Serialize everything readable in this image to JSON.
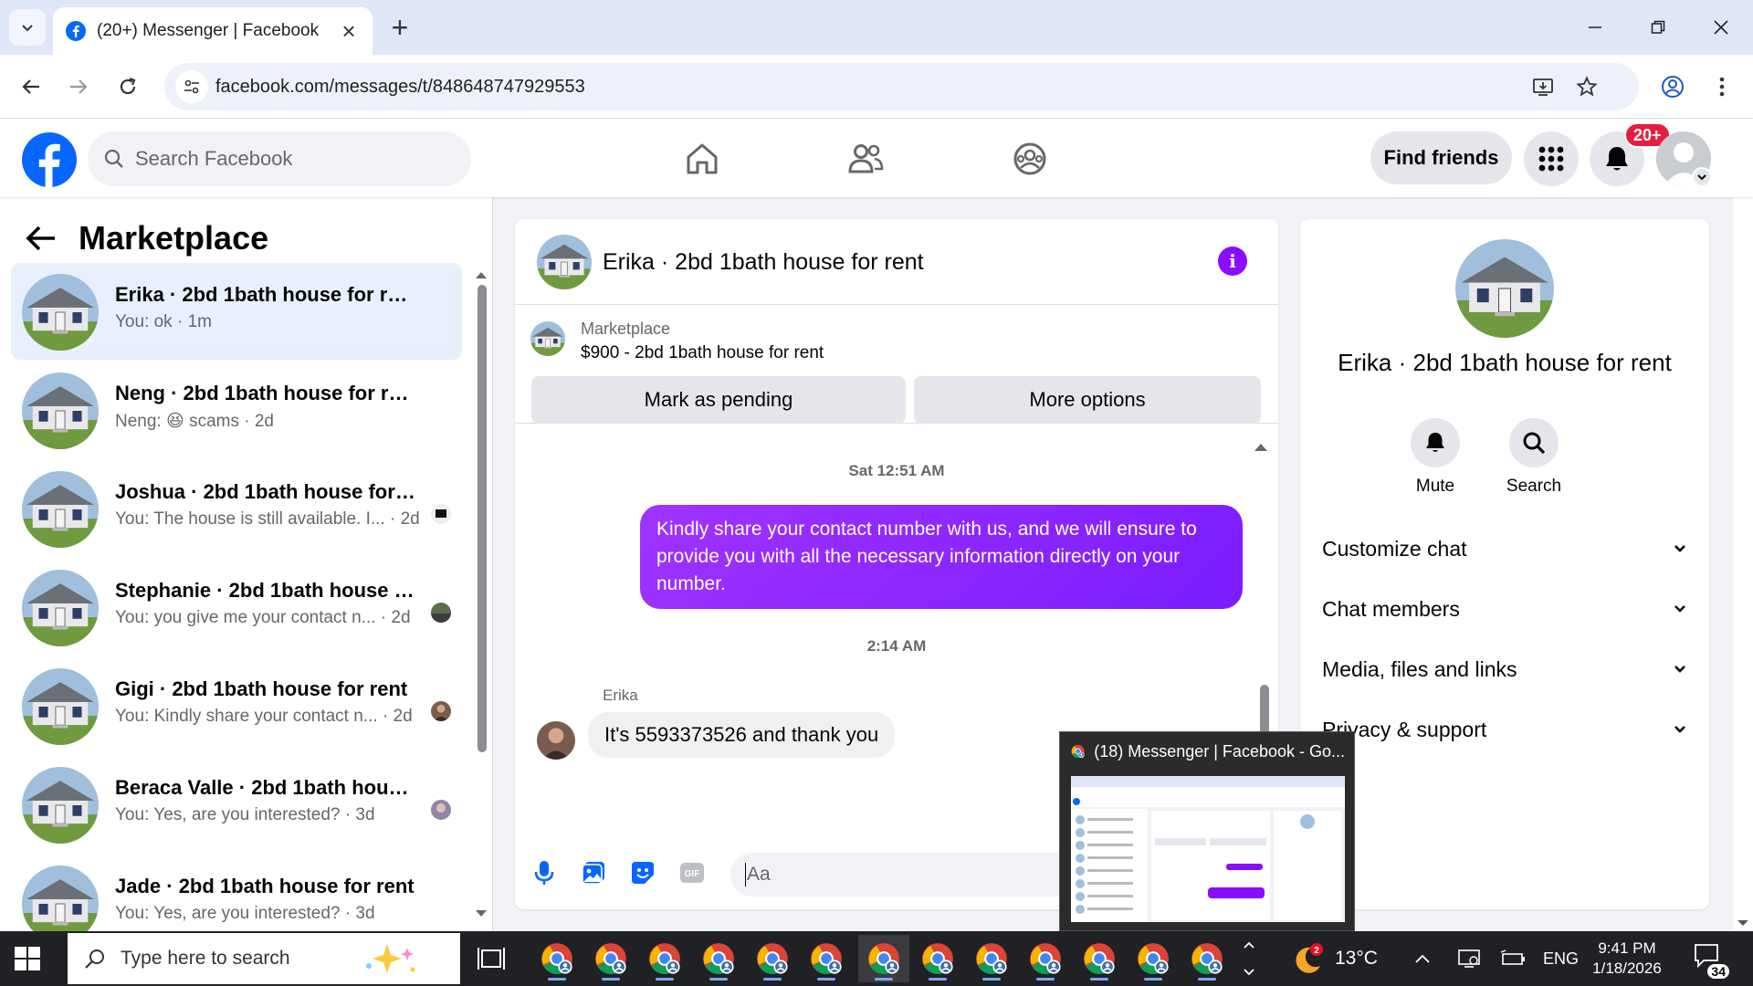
{
  "browser": {
    "tab_title": "(20+) Messenger | Facebook",
    "url": "facebook.com/messages/t/848648747929553"
  },
  "facebook": {
    "search_placeholder": "Search Facebook",
    "find_friends": "Find friends",
    "notif_badge": "20+"
  },
  "sidebar": {
    "title": "Marketplace",
    "conversations": [
      {
        "name": "Erika · 2bd 1bath house for rent",
        "preview": "You: ok · 1m",
        "active": true
      },
      {
        "name": "Neng · 2bd 1bath house for rent",
        "preview": "Neng: 😆 scams · 2d"
      },
      {
        "name": "Joshua · 2bd 1bath house for r...",
        "preview": "You: The house is still available. I... · 2d"
      },
      {
        "name": "Stephanie · 2bd 1bath house f...",
        "preview": "You: you give me your contact n... · 2d"
      },
      {
        "name": "Gigi · 2bd 1bath house for rent",
        "preview": "You: Kindly share your contact n... · 2d"
      },
      {
        "name": "Beraca Valle · 2bd 1bath hous...",
        "preview": "You: Yes, are you interested? · 3d"
      },
      {
        "name": "Jade · 2bd 1bath house for rent",
        "preview": "You: Yes, are you interested? · 3d"
      }
    ]
  },
  "chat": {
    "title": "Erika · 2bd 1bath house for rent",
    "marketplace_label": "Marketplace",
    "listing": "$900 - 2bd 1bath house for rent",
    "mark_pending": "Mark as pending",
    "more_options": "More options",
    "timestamp1": "Sat 12:51 AM",
    "outgoing_message": "Kindly share your contact number with us, and we will ensure to provide you with all the necessary information directly on your number.",
    "timestamp2": "2:14 AM",
    "sender_name": "Erika",
    "incoming_message": "It's 5593373526 and thank you",
    "composer_placeholder": "Aa"
  },
  "info_panel": {
    "name": "Erika · 2bd 1bath house for rent",
    "mute": "Mute",
    "search": "Search",
    "sections": [
      "Customize chat",
      "Chat members",
      "Media, files and links",
      "Privacy & support"
    ]
  },
  "taskbar": {
    "search_placeholder": "Type here to search",
    "preview_title": "(18) Messenger | Facebook - Go...",
    "weather_badge": "2",
    "temperature": "13°C",
    "language": "ENG",
    "time": "9:41 PM",
    "date": "1/18/2026",
    "notification_count": "34"
  },
  "colors": {
    "facebook_blue": "#0866ff",
    "messenger_purple": "#8a0dff",
    "active_conversation": "#e7f0fc"
  }
}
